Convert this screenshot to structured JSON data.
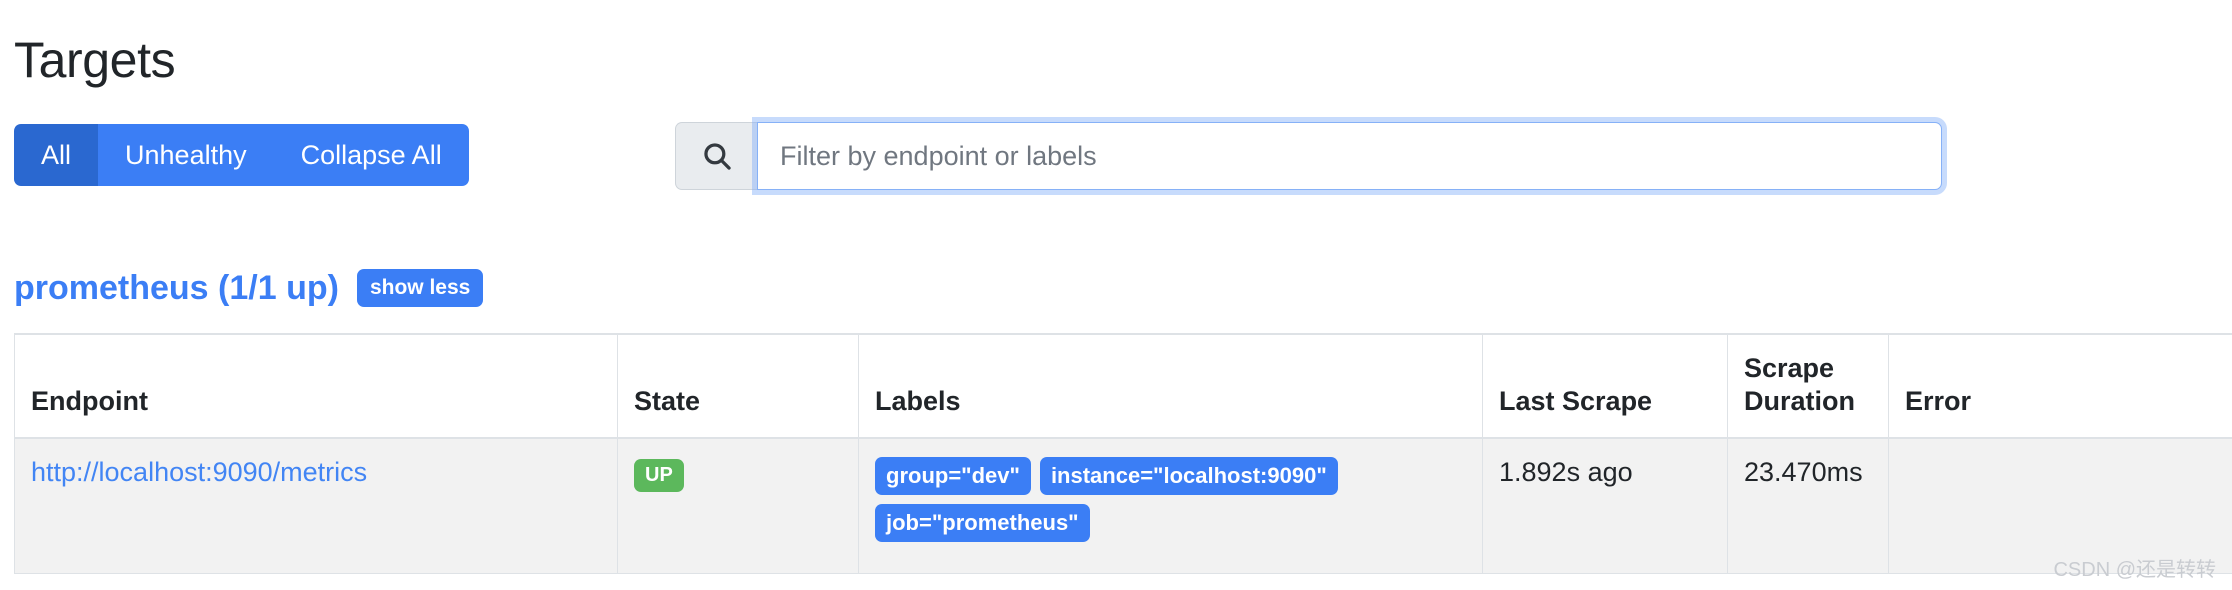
{
  "page": {
    "title": "Targets"
  },
  "toolbar": {
    "filters": [
      {
        "label": "All",
        "active": true
      },
      {
        "label": "Unhealthy",
        "active": false
      },
      {
        "label": "Collapse All",
        "active": false
      }
    ],
    "search": {
      "icon": "search-icon",
      "value": "",
      "placeholder": "Filter by endpoint or labels"
    }
  },
  "jobs": [
    {
      "title": "prometheus (1/1 up)",
      "toggle_label": "show less",
      "columns": [
        "Endpoint",
        "State",
        "Labels",
        "Last Scrape",
        "Scrape Duration",
        "Error"
      ],
      "rows": [
        {
          "endpoint": "http://localhost:9090/metrics",
          "state": "UP",
          "labels": [
            "group=\"dev\"",
            "instance=\"localhost:9090\"",
            "job=\"prometheus\""
          ],
          "last_scrape": "1.892s ago",
          "scrape_duration": "23.470ms",
          "error": ""
        }
      ]
    }
  ],
  "watermark": "CSDN @还是转转",
  "colors": {
    "primary": "#3b7ef5",
    "primary_active": "#2a68d0",
    "link": "#4285f4",
    "success": "#5cb85c",
    "row_bg": "#f2f2f2",
    "border": "#dee2e6",
    "text": "#212529"
  }
}
